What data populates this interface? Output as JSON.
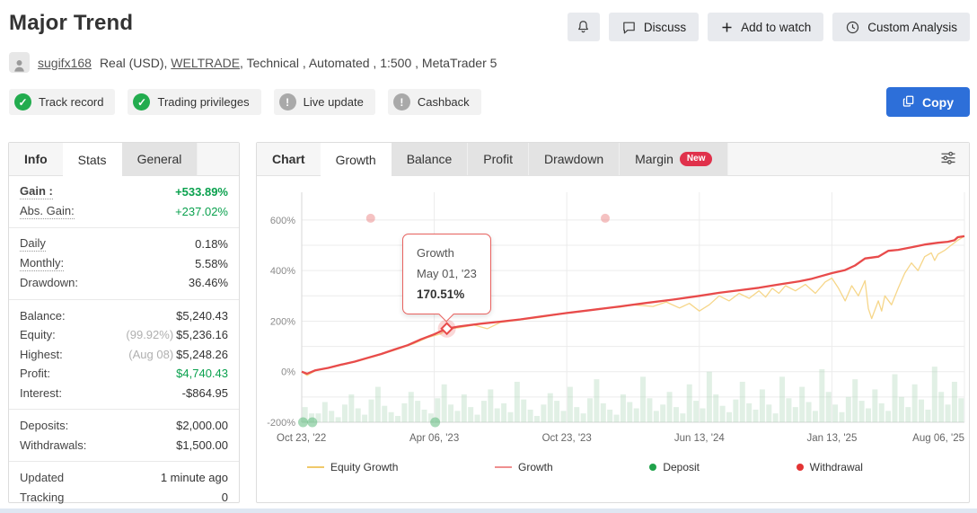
{
  "header": {
    "title": "Major Trend",
    "discuss_label": "Discuss",
    "add_watch_label": "Add to watch",
    "custom_analysis_label": "Custom Analysis"
  },
  "account": {
    "username": "sugifx168",
    "pre_broker": "Real (USD),",
    "broker": "WELTRADE",
    "post_broker": ", Technical , Automated , 1:500 , MetaTrader 5"
  },
  "badges": {
    "track_record": "Track record",
    "trading_privileges": "Trading privileges",
    "live_update": "Live update",
    "cashback": "Cashback",
    "copy_label": "Copy"
  },
  "info_panel": {
    "tabs": {
      "info": "Info",
      "stats": "Stats",
      "general": "General"
    },
    "active_tab": "Stats",
    "groups": [
      [
        {
          "label": "Gain :",
          "value": "+533.89%"
        },
        {
          "label": "Abs. Gain:",
          "value": "+237.02%"
        }
      ],
      [
        {
          "label": "Daily",
          "value": "0.18%"
        },
        {
          "label": "Monthly:",
          "value": "5.58%"
        },
        {
          "label": "Drawdown:",
          "value": "36.46%"
        }
      ],
      [
        {
          "label": "Balance:",
          "value": "$5,240.43"
        },
        {
          "label": "Equity:",
          "prefix": "(99.92%)",
          "value": "$5,236.16"
        },
        {
          "label": "Highest:",
          "prefix": "(Aug 08)",
          "value": "$5,248.26"
        },
        {
          "label": "Profit:",
          "value": "$4,740.43"
        },
        {
          "label": "Interest:",
          "value": "-$864.95"
        }
      ],
      [
        {
          "label": "Deposits:",
          "value": "$2,000.00"
        },
        {
          "label": "Withdrawals:",
          "value": "$1,500.00"
        }
      ],
      [
        {
          "label": "Updated",
          "value": "1 minute ago"
        },
        {
          "label": "Tracking",
          "value": "0"
        }
      ]
    ]
  },
  "chart_panel": {
    "label": "Chart",
    "tabs": {
      "growth": "Growth",
      "balance": "Balance",
      "profit": "Profit",
      "drawdown": "Drawdown",
      "margin": "Margin"
    },
    "margin_badge": "New",
    "active_tab": "Growth"
  },
  "chart_data": {
    "type": "line",
    "title": "Growth",
    "x_ticks": [
      "Oct 23, '22",
      "Apr 06, '23",
      "Oct 23, '23",
      "Jun 13, '24",
      "Jan 13, '25",
      "Aug 06, '25"
    ],
    "x_tick_fractions": [
      0,
      0.2,
      0.4,
      0.6,
      0.8,
      1
    ],
    "y_ticks": [
      -200,
      0,
      200,
      400,
      600
    ],
    "ylim": [
      -200,
      660
    ],
    "grid": true,
    "legend_position": "bottom",
    "series": [
      {
        "name": "Equity Growth",
        "color": "#f5d483",
        "points": [
          [
            0,
            0
          ],
          [
            0.008,
            -15
          ],
          [
            0.02,
            3
          ],
          [
            0.05,
            20
          ],
          [
            0.08,
            38
          ],
          [
            0.11,
            60
          ],
          [
            0.14,
            85
          ],
          [
            0.17,
            112
          ],
          [
            0.19,
            135
          ],
          [
            0.21,
            150
          ],
          [
            0.22,
            168
          ],
          [
            0.24,
            175
          ],
          [
            0.26,
            185
          ],
          [
            0.28,
            170
          ],
          [
            0.3,
            195
          ],
          [
            0.33,
            205
          ],
          [
            0.36,
            215
          ],
          [
            0.39,
            228
          ],
          [
            0.42,
            238
          ],
          [
            0.45,
            250
          ],
          [
            0.48,
            255
          ],
          [
            0.5,
            265
          ],
          [
            0.53,
            258
          ],
          [
            0.55,
            276
          ],
          [
            0.57,
            252
          ],
          [
            0.585,
            270
          ],
          [
            0.6,
            240
          ],
          [
            0.615,
            265
          ],
          [
            0.63,
            300
          ],
          [
            0.645,
            280
          ],
          [
            0.66,
            310
          ],
          [
            0.675,
            290
          ],
          [
            0.69,
            320
          ],
          [
            0.7,
            295
          ],
          [
            0.71,
            330
          ],
          [
            0.72,
            310
          ],
          [
            0.73,
            340
          ],
          [
            0.745,
            320
          ],
          [
            0.76,
            345
          ],
          [
            0.775,
            310
          ],
          [
            0.79,
            355
          ],
          [
            0.8,
            370
          ],
          [
            0.81,
            330
          ],
          [
            0.82,
            280
          ],
          [
            0.83,
            340
          ],
          [
            0.84,
            300
          ],
          [
            0.85,
            360
          ],
          [
            0.855,
            250
          ],
          [
            0.86,
            210
          ],
          [
            0.87,
            280
          ],
          [
            0.875,
            240
          ],
          [
            0.88,
            300
          ],
          [
            0.89,
            265
          ],
          [
            0.9,
            330
          ],
          [
            0.905,
            360
          ],
          [
            0.91,
            390
          ],
          [
            0.92,
            430
          ],
          [
            0.93,
            400
          ],
          [
            0.94,
            455
          ],
          [
            0.95,
            470
          ],
          [
            0.955,
            440
          ],
          [
            0.96,
            465
          ],
          [
            0.97,
            480
          ],
          [
            0.98,
            500
          ],
          [
            0.99,
            520
          ],
          [
            1,
            536
          ]
        ]
      },
      {
        "name": "Growth",
        "color": "#e84b4b",
        "points": [
          [
            0,
            0
          ],
          [
            0.008,
            -8
          ],
          [
            0.02,
            5
          ],
          [
            0.04,
            15
          ],
          [
            0.06,
            28
          ],
          [
            0.08,
            40
          ],
          [
            0.1,
            55
          ],
          [
            0.12,
            70
          ],
          [
            0.14,
            88
          ],
          [
            0.16,
            105
          ],
          [
            0.18,
            128
          ],
          [
            0.2,
            148
          ],
          [
            0.219,
            170.51
          ],
          [
            0.24,
            180
          ],
          [
            0.27,
            190
          ],
          [
            0.3,
            198
          ],
          [
            0.33,
            207
          ],
          [
            0.36,
            218
          ],
          [
            0.4,
            232
          ],
          [
            0.44,
            245
          ],
          [
            0.48,
            258
          ],
          [
            0.52,
            272
          ],
          [
            0.56,
            285
          ],
          [
            0.6,
            300
          ],
          [
            0.63,
            312
          ],
          [
            0.66,
            322
          ],
          [
            0.69,
            332
          ],
          [
            0.72,
            345
          ],
          [
            0.75,
            357
          ],
          [
            0.77,
            368
          ],
          [
            0.8,
            390
          ],
          [
            0.82,
            402
          ],
          [
            0.835,
            420
          ],
          [
            0.85,
            448
          ],
          [
            0.87,
            455
          ],
          [
            0.885,
            478
          ],
          [
            0.9,
            482
          ],
          [
            0.92,
            492
          ],
          [
            0.94,
            503
          ],
          [
            0.96,
            510
          ],
          [
            0.975,
            514
          ],
          [
            0.985,
            520
          ],
          [
            0.99,
            532
          ],
          [
            1,
            536
          ]
        ]
      }
    ],
    "markers": {
      "deposits": {
        "color": "rgba(94,187,125,0.55)",
        "points": [
          [
            0.002,
            -200
          ],
          [
            0.016,
            -200
          ],
          [
            0.2014,
            -200
          ]
        ]
      },
      "withdrawals": {
        "color": "rgba(233,120,120,0.45)",
        "points": [
          [
            0.104,
            607
          ],
          [
            0.458,
            607
          ]
        ]
      }
    },
    "volume_bars": [
      60,
      35,
      35,
      80,
      45,
      20,
      70,
      110,
      55,
      30,
      90,
      140,
      65,
      40,
      25,
      75,
      120,
      85,
      50,
      35,
      95,
      150,
      70,
      45,
      110,
      60,
      30,
      85,
      130,
      55,
      75,
      40,
      160,
      90,
      50,
      25,
      70,
      115,
      85,
      45,
      140,
      60,
      35,
      95,
      170,
      75,
      50,
      30,
      110,
      80,
      55,
      180,
      95,
      45,
      70,
      120,
      60,
      35,
      150,
      85,
      55,
      200,
      110,
      65,
      40,
      90,
      160,
      75,
      50,
      130,
      70,
      35,
      180,
      95,
      60,
      140,
      80,
      45,
      210,
      120,
      70,
      40,
      100,
      170,
      85,
      55,
      130,
      75,
      45,
      190,
      100,
      60,
      150,
      90,
      50,
      220,
      120,
      70,
      160,
      95
    ],
    "tooltip": {
      "series": "Growth",
      "date": "May 01, '23",
      "value": "170.51%",
      "t": 0.219,
      "v": 170.51
    },
    "legend": [
      {
        "label": "Equity Growth",
        "type": "line",
        "color": "#f0c96a"
      },
      {
        "label": "Growth",
        "type": "line",
        "color": "#ef8f8f"
      },
      {
        "label": "Deposit",
        "type": "dot",
        "color": "#1fa24a"
      },
      {
        "label": "Withdrawal",
        "type": "dot",
        "color": "#e33434"
      }
    ]
  }
}
